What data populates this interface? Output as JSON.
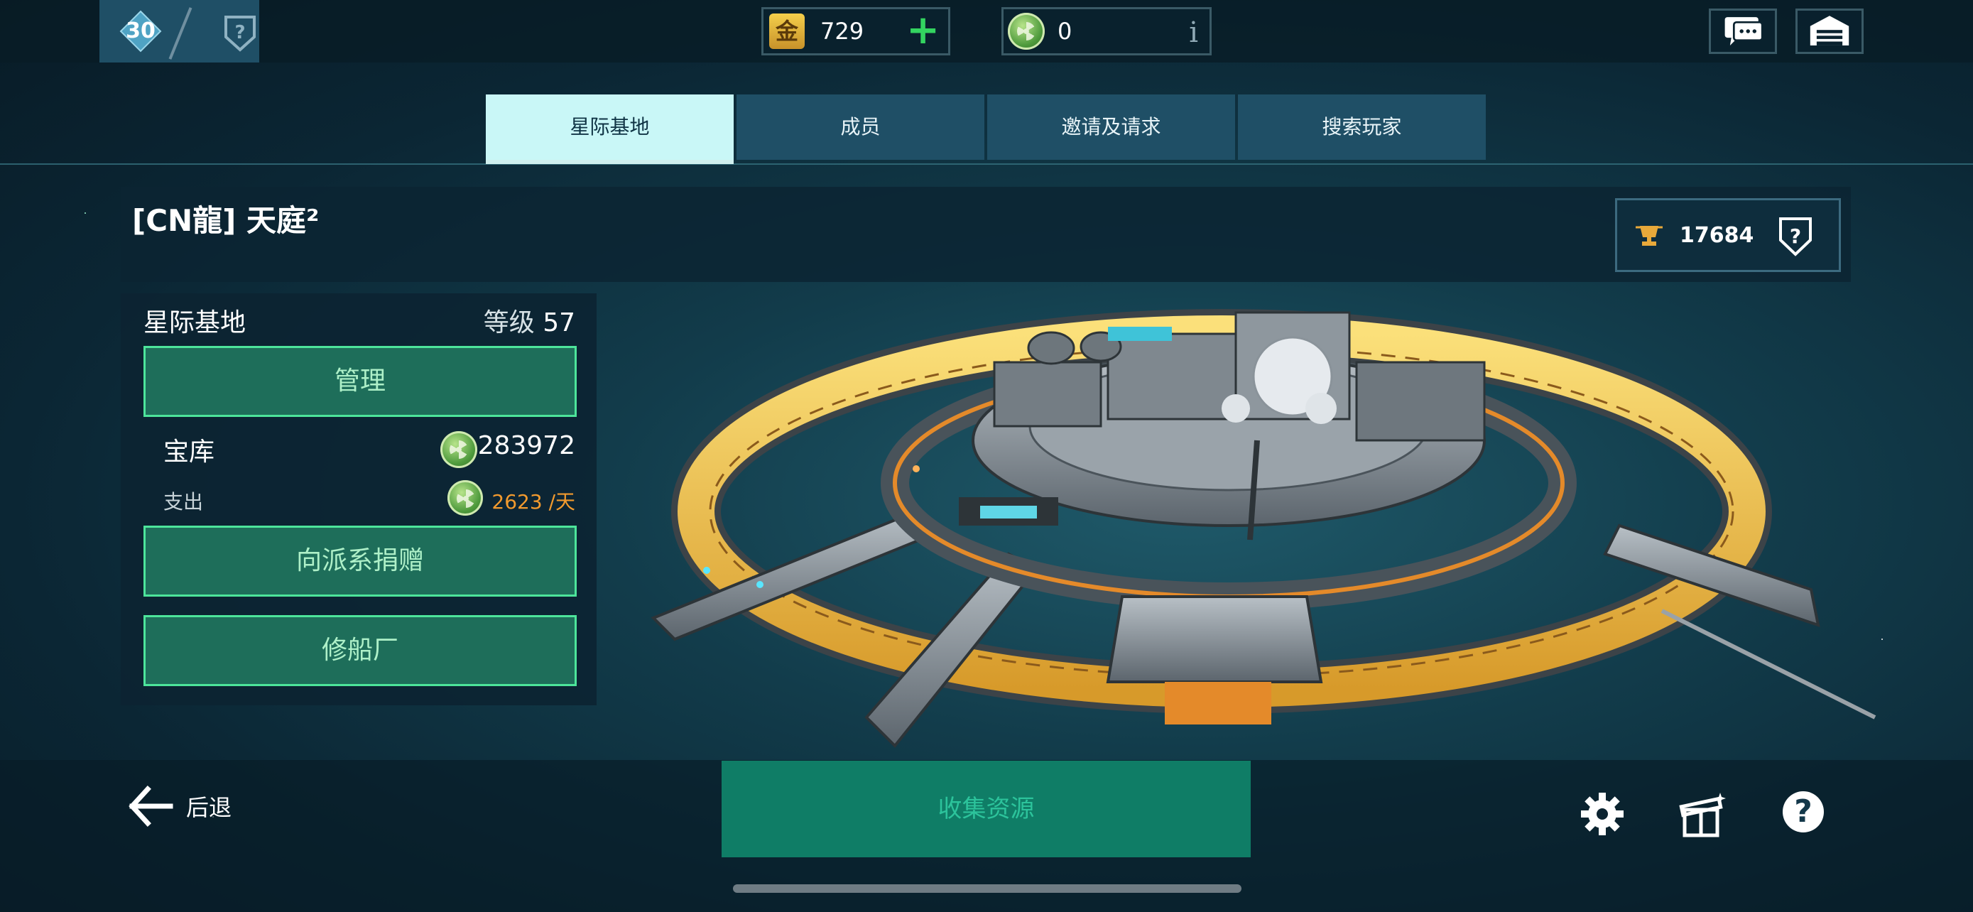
{
  "top": {
    "rank": "30",
    "gold": "729",
    "green_currency": "0",
    "gold_glyph": "金",
    "info_glyph": "i"
  },
  "tabs": [
    {
      "label": "星际基地",
      "active": true
    },
    {
      "label": "成员",
      "active": false
    },
    {
      "label": "邀请及请求",
      "active": false
    },
    {
      "label": "搜索玩家",
      "active": false
    }
  ],
  "header": {
    "faction_name": "[CN龍] 天庭²",
    "trophies": "17684"
  },
  "base_panel": {
    "title": "星际基地",
    "level_label": "等级",
    "level": "57",
    "manage_label": "管理",
    "vault_label": "宝库",
    "vault_value": "283972",
    "expense_label": "支出",
    "expense_value": "2623 /天",
    "donate_label": "向派系捐赠",
    "shipyard_label": "修船厂"
  },
  "bottom": {
    "back_label": "后退",
    "collect_label": "收集资源",
    "help_glyph": "?"
  },
  "colors": {
    "accent_green": "#4de59b",
    "tab_active": "#c9f7f7",
    "tab_inactive": "#1f4f66",
    "expense_orange": "#f29a2e",
    "collect_green": "#0f7d66"
  }
}
